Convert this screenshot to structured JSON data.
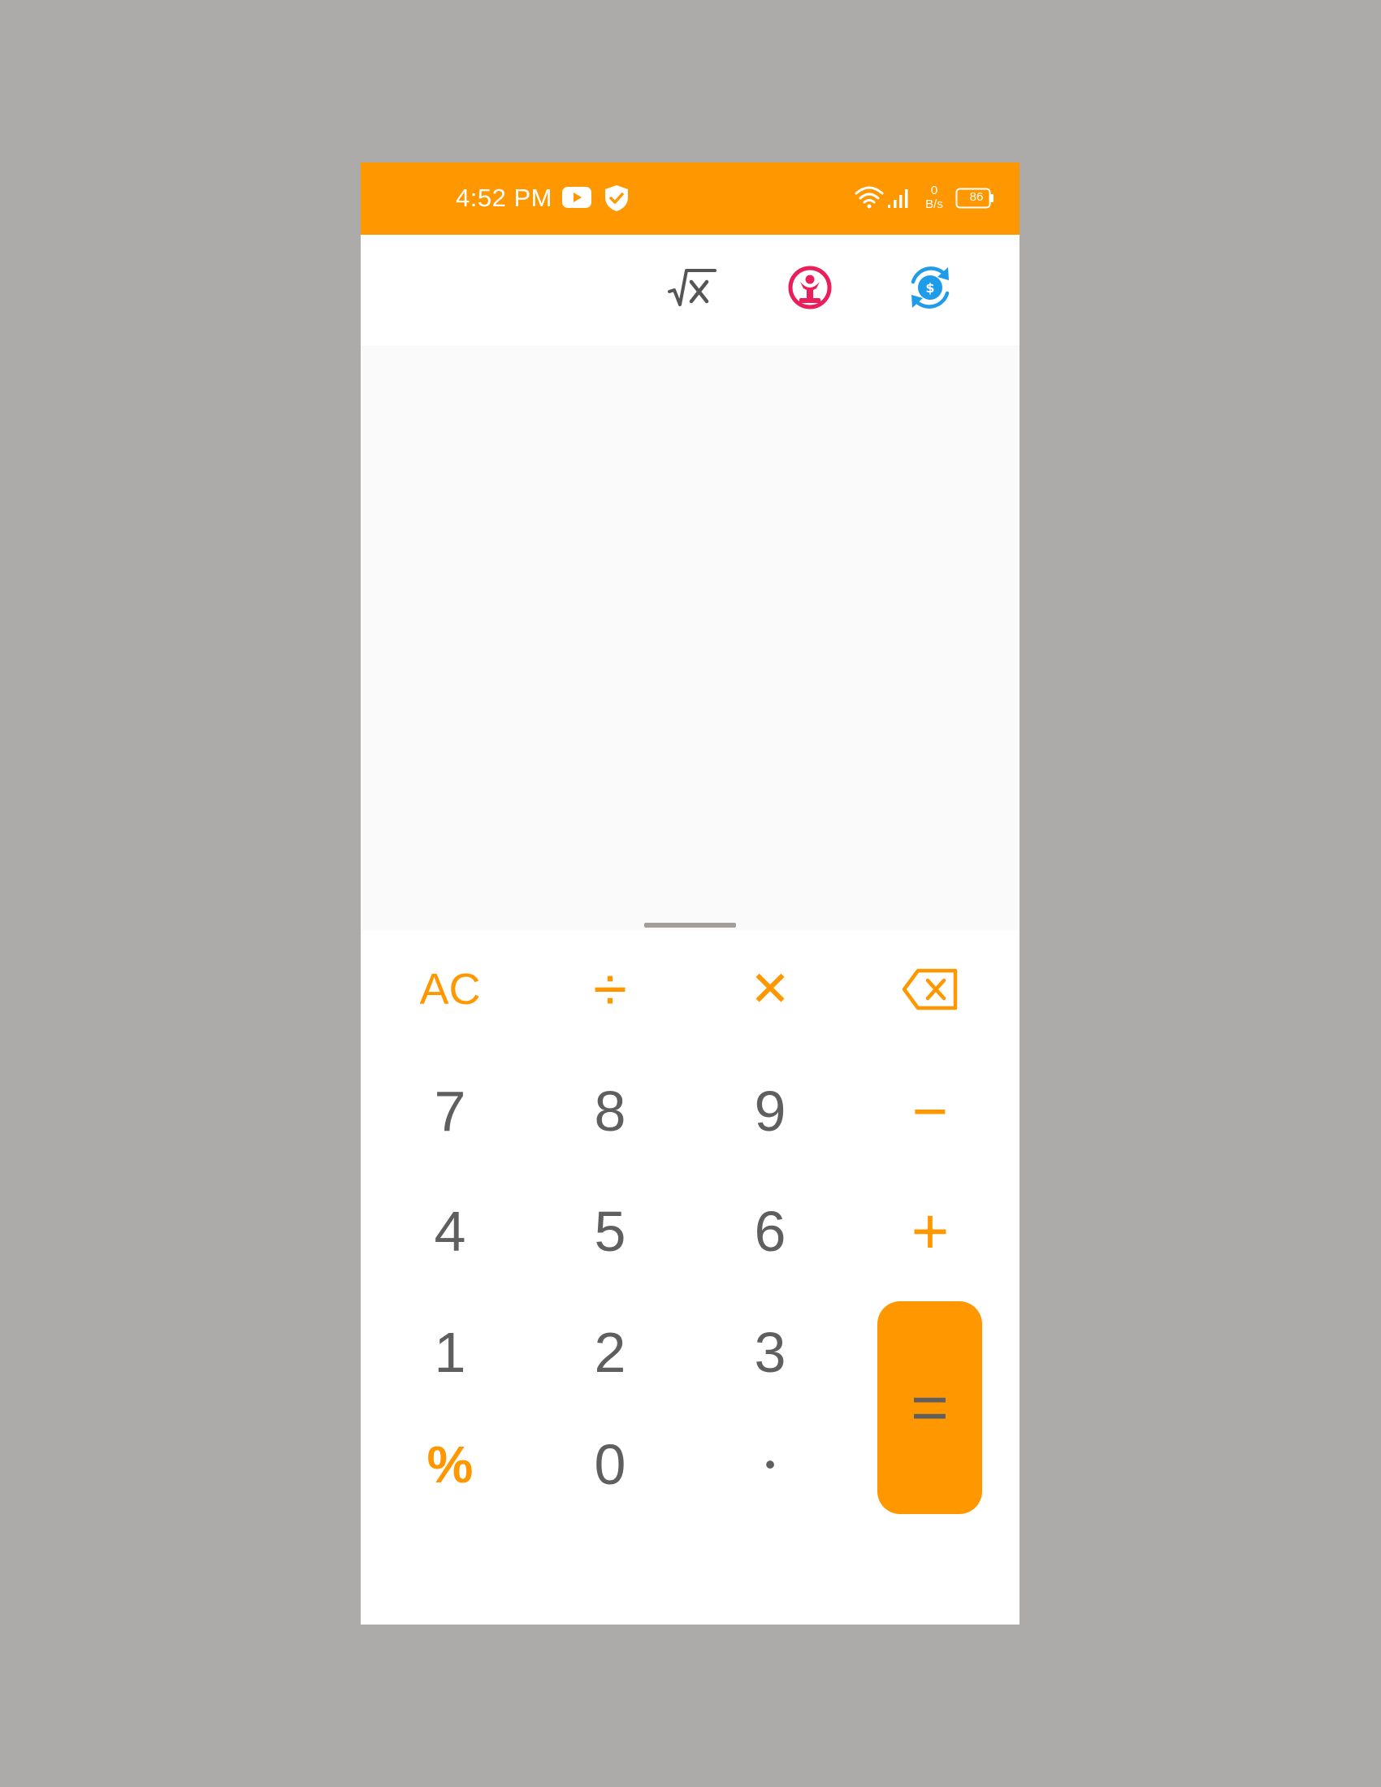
{
  "status_bar": {
    "time": "4:52 PM",
    "net_speed_value": "0",
    "net_speed_unit": "B/s",
    "battery": "86",
    "background": "#ff9800"
  },
  "toolbar": {
    "icons": [
      "sqrt-x-icon",
      "bmi-person-icon",
      "currency-exchange-icon"
    ],
    "colors": {
      "sqrt": "#555555",
      "bmi": "#e91e5a",
      "currency": "#1e9be9"
    }
  },
  "display": {
    "expression": "",
    "result": ""
  },
  "keypad": {
    "accent": "#ff9800",
    "digit_color": "#5f5f5f",
    "row1": {
      "clear": "AC",
      "divide": "÷",
      "multiply": "✕",
      "backspace_icon": "backspace-icon"
    },
    "row2": {
      "seven": "7",
      "eight": "8",
      "nine": "9",
      "minus": "−"
    },
    "row3": {
      "four": "4",
      "five": "5",
      "six": "6",
      "plus": "+"
    },
    "row4": {
      "one": "1",
      "two": "2",
      "three": "3"
    },
    "row5": {
      "percent": "%",
      "zero": "0",
      "dot": "•"
    },
    "equals": "="
  }
}
